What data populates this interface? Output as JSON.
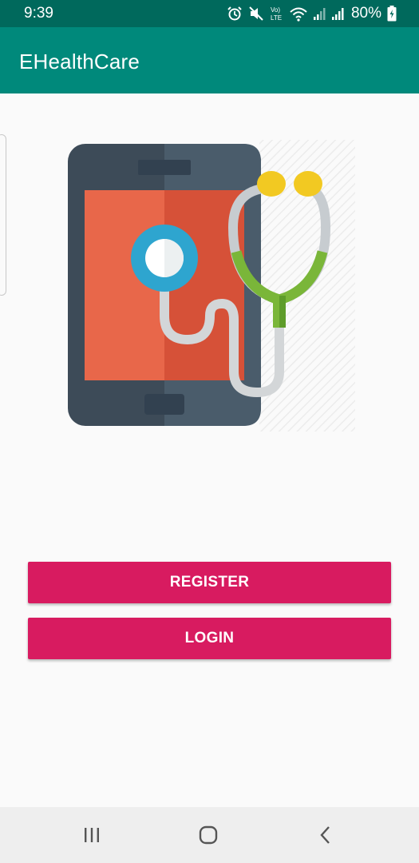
{
  "status_bar": {
    "time": "9:39",
    "battery_text": "80%",
    "icons": [
      "alarm-icon",
      "mute-icon",
      "volte-icon",
      "wifi-icon",
      "signal-icon",
      "signal-icon",
      "battery-charging-icon"
    ]
  },
  "app_bar": {
    "title": "EHealthCare",
    "color": "#00897b",
    "status_color": "#00695c"
  },
  "hero": {
    "icon": "phone-stethoscope-illustration"
  },
  "buttons": {
    "register_label": "REGISTER",
    "login_label": "LOGIN",
    "accent": "#d81b60"
  },
  "nav_bar": {
    "icons": [
      "recents-icon",
      "home-icon",
      "back-icon"
    ]
  }
}
